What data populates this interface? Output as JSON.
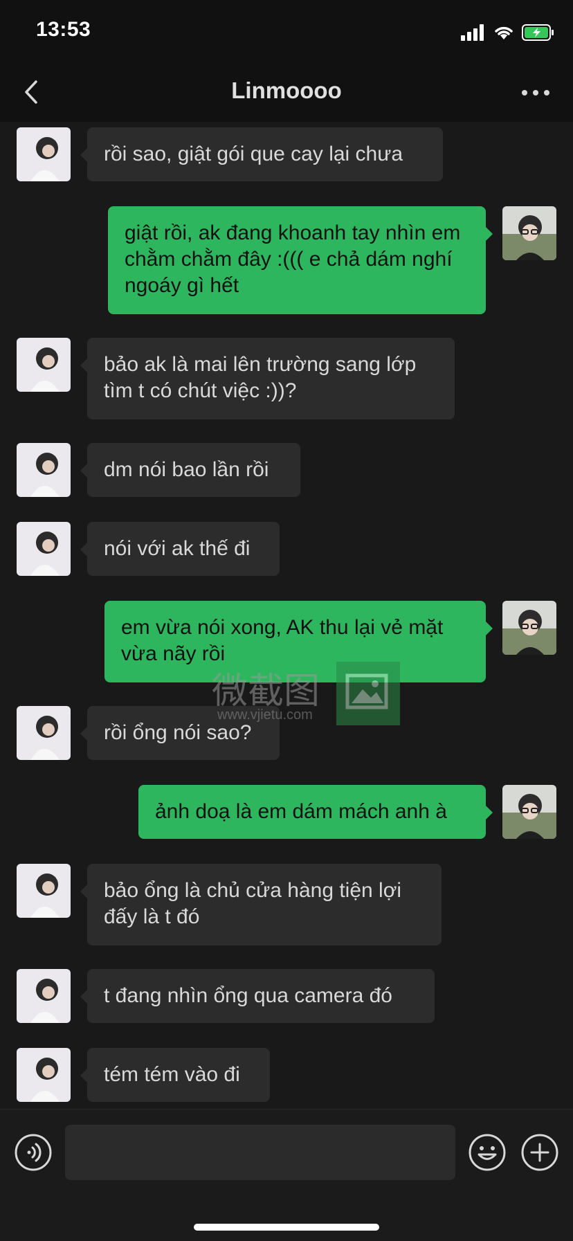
{
  "status": {
    "time": "13:53"
  },
  "header": {
    "title": "Linmoooo"
  },
  "colors": {
    "incoming_bubble": "#2c2c2c",
    "outgoing_bubble": "#2eb65f",
    "background": "#191919"
  },
  "messages": [
    {
      "side": "in",
      "text": "rồi sao, giật gói que cay lại chưa"
    },
    {
      "side": "out",
      "text": "giật rồi, ak đang khoanh tay nhìn em chằm chằm đây :((( e chả dám nghí ngoáy gì hết"
    },
    {
      "side": "in",
      "text": "bảo ak là mai lên trường sang lớp tìm t có chút việc :))?"
    },
    {
      "side": "in",
      "text": "dm nói bao lần rồi"
    },
    {
      "side": "in",
      "text": "nói với ak thế đi"
    },
    {
      "side": "out",
      "text": "em vừa nói xong, AK thu lại vẻ mặt vừa nãy rồi"
    },
    {
      "side": "in",
      "text": "rồi ổng nói sao?"
    },
    {
      "side": "out",
      "text": "ảnh doạ là em dám mách anh à"
    },
    {
      "side": "in",
      "text": "bảo ổng là chủ cửa hàng tiện lợi đấy là t đó"
    },
    {
      "side": "in",
      "text": "t đang nhìn ổng qua camera đó"
    },
    {
      "side": "in",
      "text": "tém tém vào đi"
    }
  ],
  "watermark": {
    "text": "微截图",
    "url": "www.vjietu.com"
  },
  "input": {
    "value": "",
    "placeholder": ""
  },
  "icons": {
    "back": "chevron-left-icon",
    "more": "more-dots-icon",
    "voice": "voice-icon",
    "emoji": "emoji-icon",
    "plus": "plus-icon"
  }
}
